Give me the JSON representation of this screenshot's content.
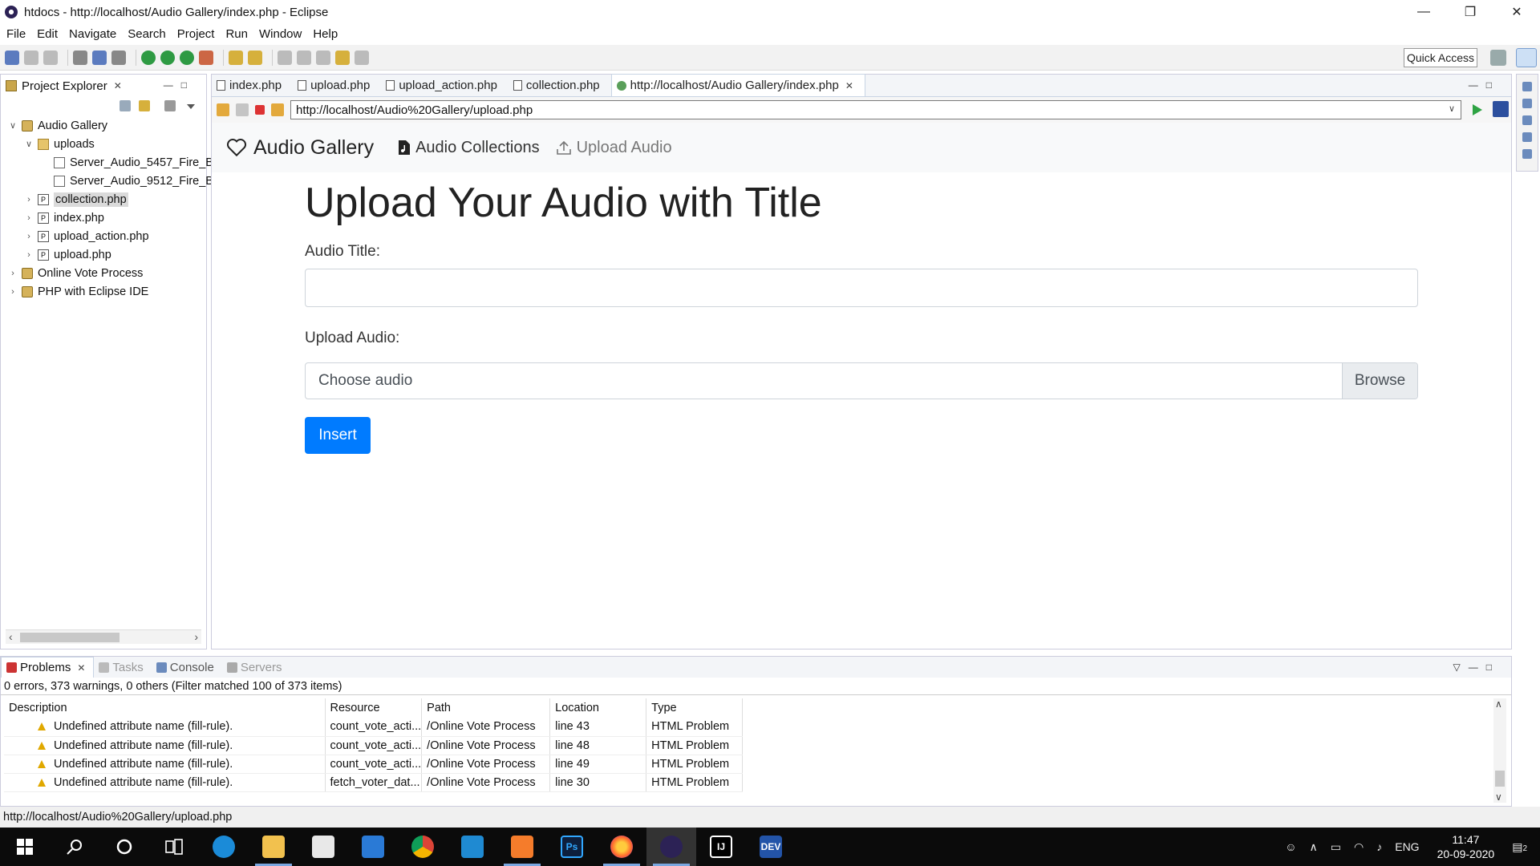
{
  "window": {
    "title": "htdocs - http://localhost/Audio Gallery/index.php - Eclipse"
  },
  "menu": [
    "File",
    "Edit",
    "Navigate",
    "Search",
    "Project",
    "Run",
    "Window",
    "Help"
  ],
  "toolbar": {
    "quick_access": "Quick Access"
  },
  "explorer": {
    "title": "Project Explorer",
    "tree": [
      {
        "label": "Audio Gallery",
        "icon": "project-icon"
      },
      {
        "label": "uploads",
        "icon": "folder-icon"
      },
      {
        "label": "Server_Audio_5457_Fire_B",
        "icon": "file-icon"
      },
      {
        "label": "Server_Audio_9512_Fire_B",
        "icon": "file-icon"
      },
      {
        "label": "collection.php",
        "icon": "php-file-icon"
      },
      {
        "label": "index.php",
        "icon": "php-file-icon"
      },
      {
        "label": "upload_action.php",
        "icon": "php-file-icon"
      },
      {
        "label": "upload.php",
        "icon": "php-file-icon"
      },
      {
        "label": "Online Vote Process",
        "icon": "project-icon"
      },
      {
        "label": "PHP with Eclipse IDE",
        "icon": "project-icon"
      }
    ]
  },
  "editor": {
    "tabs": [
      {
        "label": "index.php"
      },
      {
        "label": "upload.php"
      },
      {
        "label": "upload_action.php"
      },
      {
        "label": "collection.php"
      },
      {
        "label": "http://localhost/Audio Gallery/index.php"
      }
    ],
    "url": "http://localhost/Audio%20Gallery/upload.php"
  },
  "webpage": {
    "brand": "Audio Gallery",
    "nav": {
      "collections": "Audio Collections",
      "upload": "Upload Audio"
    },
    "heading": "Upload Your Audio with Title",
    "title_label": "Audio Title:",
    "title_value": "",
    "upload_label": "Upload Audio:",
    "file_placeholder": "Choose audio",
    "browse": "Browse",
    "insert": "Insert",
    "primary_color": "#007bff"
  },
  "bottom": {
    "tabs": {
      "problems": "Problems",
      "tasks": "Tasks",
      "console": "Console",
      "servers": "Servers"
    },
    "summary": "0 errors, 373 warnings, 0 others (Filter matched 100 of 373 items)",
    "columns": [
      "Description",
      "Resource",
      "Path",
      "Location",
      "Type"
    ],
    "rows": [
      [
        "Undefined attribute name (fill-rule).",
        "count_vote_acti...",
        "/Online Vote Process",
        "line 43",
        "HTML Problem"
      ],
      [
        "Undefined attribute name (fill-rule).",
        "count_vote_acti...",
        "/Online Vote Process",
        "line 48",
        "HTML Problem"
      ],
      [
        "Undefined attribute name (fill-rule).",
        "count_vote_acti...",
        "/Online Vote Process",
        "line 49",
        "HTML Problem"
      ],
      [
        "Undefined attribute name (fill-rule).",
        "fetch_voter_dat...",
        "/Online Vote Process",
        "line 30",
        "HTML Problem"
      ]
    ]
  },
  "statusbar": {
    "text": "http://localhost/Audio%20Gallery/upload.php"
  },
  "taskbar": {
    "apps": [
      "Edge",
      "File Explorer",
      "Store",
      "Mail",
      "Chrome",
      "VS Code",
      "XAMPP",
      "Photoshop",
      "Firefox",
      "Eclipse",
      "IntelliJ",
      "Dev-C++"
    ],
    "lang": "ENG",
    "time": "11:47",
    "date": "20-09-2020",
    "notifications": "2"
  }
}
